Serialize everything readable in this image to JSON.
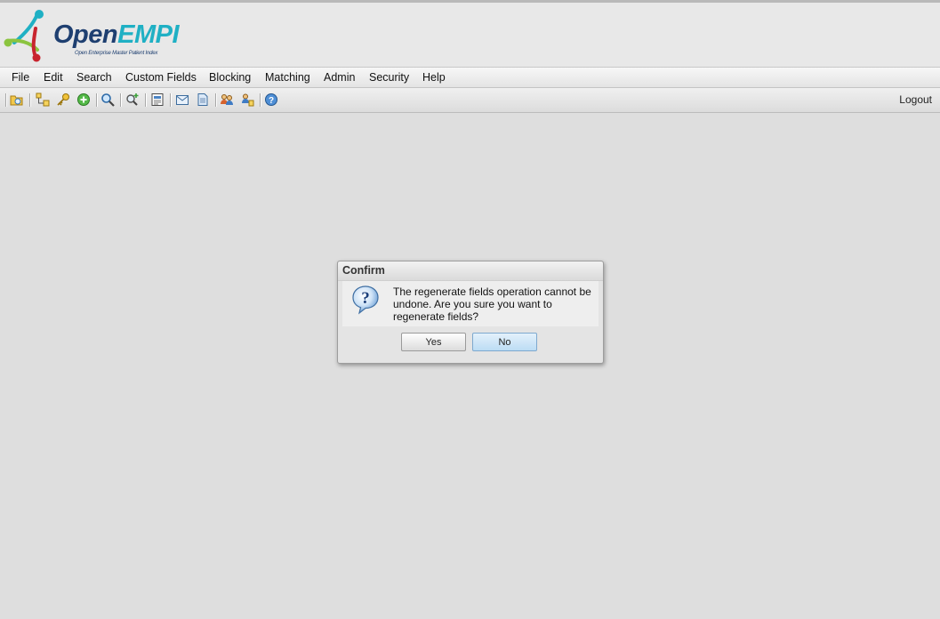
{
  "app": {
    "logo_open": "Open",
    "logo_empi": "EMPI",
    "logo_tagline": "Open Enterprise Master Patient Index"
  },
  "menu": [
    {
      "label": "File"
    },
    {
      "label": "Edit"
    },
    {
      "label": "Search"
    },
    {
      "label": "Custom Fields"
    },
    {
      "label": "Blocking"
    },
    {
      "label": "Matching"
    },
    {
      "label": "Admin"
    },
    {
      "label": "Security"
    },
    {
      "label": "Help"
    }
  ],
  "toolbar": {
    "icons": [
      "open-folder-icon",
      "hierarchy-icon",
      "key-icon",
      "add-icon",
      "search-icon",
      "advanced-search-icon",
      "report-icon",
      "email-icon",
      "document-icon",
      "users-icon",
      "user-link-icon",
      "help-icon"
    ],
    "logout_label": "Logout"
  },
  "dialog": {
    "title": "Confirm",
    "message": "The regenerate fields operation cannot be undone. Are you sure you want to regenerate fields?",
    "icon": "question-icon",
    "yes_label": "Yes",
    "no_label": "No"
  },
  "colors": {
    "page_background": "#dedede",
    "logo_dark": "#1e3f70",
    "logo_accent": "#1fb0c4",
    "default_button": "#bcdcf4"
  }
}
